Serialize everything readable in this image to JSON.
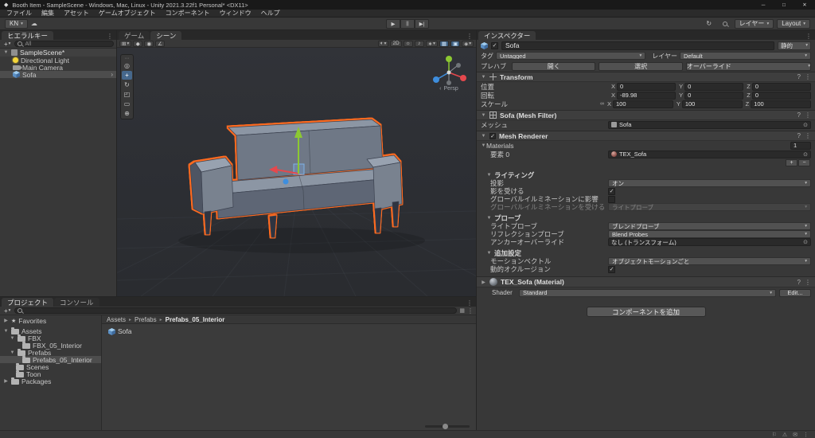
{
  "window": {
    "title": "Booth Item - SampleScene - Windows, Mac, Linux - Unity 2021.3.22f1 Personal* <DX11>"
  },
  "menu": {
    "items": [
      "ファイル",
      "編集",
      "アセット",
      "ゲームオブジェクト",
      "コンポーネント",
      "ウィンドウ",
      "ヘルプ"
    ]
  },
  "toolbar": {
    "account": "KN",
    "layers": "レイヤー",
    "layout": "Layout"
  },
  "hierarchy": {
    "tab": "ヒエラルキー",
    "search_filter": "All",
    "scene_row": "SampleScene*",
    "items": [
      {
        "label": "Directional Light"
      },
      {
        "label": "Main Camera"
      },
      {
        "label": "Sofa"
      }
    ]
  },
  "scene": {
    "tabs": [
      {
        "label": "ゲーム"
      },
      {
        "label": "シーン"
      }
    ],
    "toggle_2d": "2D",
    "persp_label": "Persp"
  },
  "inspector": {
    "tab": "インスペクター",
    "header": {
      "name": "Sofa",
      "static_label": "静的"
    },
    "tag": {
      "label": "タグ",
      "value": "Untagged"
    },
    "layer": {
      "label": "レイヤー",
      "value": "Default"
    },
    "prefab": {
      "label": "プレハブ",
      "open": "開く",
      "select": "選択",
      "overrides": "オーバーライド"
    },
    "transform": {
      "title": "Transform",
      "axis_x": "X",
      "axis_y": "Y",
      "axis_z": "Z",
      "rows": [
        {
          "label": "位置",
          "x": "0",
          "y": "0",
          "z": "0"
        },
        {
          "label": "回転",
          "x": "-89.98",
          "y": "0",
          "z": "0"
        },
        {
          "label": "スケール",
          "x": "100",
          "y": "100",
          "z": "100"
        }
      ]
    },
    "mesh_filter": {
      "title": "Sofa (Mesh Filter)",
      "mesh_label": "メッシュ",
      "mesh_value": "Sofa"
    },
    "mesh_renderer": {
      "title": "Mesh Renderer",
      "materials": {
        "label": "Materials",
        "count": "1",
        "element_label": "要素 0",
        "element_value": "TEX_Sofa"
      },
      "lighting": {
        "title": "ライティング",
        "cast_shadows_label": "投影",
        "cast_shadows_value": "オン",
        "receive_shadows_label": "影を受ける",
        "contribute_gi_label": "グローバルイルミネーションに影響",
        "receive_gi_label": "グローバルイルミネーションを受ける",
        "receive_gi_value": "ライトプローブ"
      },
      "probes": {
        "title": "プローブ",
        "light_probes_label": "ライトプローブ",
        "light_probes_value": "ブレンドプローブ",
        "reflection_probes_label": "リフレクションプローブ",
        "reflection_probes_value": "Blend Probes",
        "anchor_label": "アンカーオーバーライド",
        "anchor_value": "なし (トランスフォーム)"
      },
      "additional": {
        "title": "追加設定",
        "motion_vectors_label": "モーションベクトル",
        "motion_vectors_value": "オブジェクトモーションごと",
        "dynamic_occlusion_label": "動的オクルージョン"
      }
    },
    "material": {
      "title": "TEX_Sofa (Material)",
      "shader_label": "Shader",
      "shader_value": "Standard",
      "edit_button": "Edit..."
    },
    "add_component": "コンポーネントを追加"
  },
  "project": {
    "tabs": [
      {
        "label": "プロジェクト"
      },
      {
        "label": "コンソール"
      }
    ],
    "favorites_label": "Favorites",
    "tree": [
      {
        "label": "Assets"
      },
      {
        "label": "FBX"
      },
      {
        "label": "FBX_05_Interior"
      },
      {
        "label": "Prefabs"
      },
      {
        "label": "Prefabs_05_Interior"
      },
      {
        "label": "Scenes"
      },
      {
        "label": "Toon"
      },
      {
        "label": "Packages"
      }
    ],
    "breadcrumb": [
      "Assets",
      "Prefabs",
      "Prefabs_05_Interior"
    ],
    "content_item": "Sofa"
  },
  "icons": {
    "unity_logo": "◆",
    "cloud": "☁",
    "dropdown": "▾",
    "foldout_open": "▼",
    "foldout_closed": "▶",
    "check": "✓",
    "more": "⋮",
    "help": "?",
    "plus": "+",
    "minus": "−",
    "play": "▶",
    "pause": "||",
    "step": "▶|",
    "minimize": "─",
    "maximize": "□",
    "close": "✕",
    "picker": "⊙",
    "link": "∞",
    "prefab_arrow": "›",
    "breadcrumb_sep": "▸",
    "star": "★",
    "collapse": "‹",
    "grip": "⋯",
    "view_tool": "◎",
    "move_tool": "+",
    "rotate_tool": "↻",
    "scale_tool": "◰",
    "rect_tool": "▭",
    "transform_tool": "⊕",
    "grid": "⊞",
    "pivot": "◆",
    "orientation": "◉",
    "snap": "∠",
    "render_mode": "◐",
    "lighting": "☼",
    "audio": "♪",
    "effects": "∗",
    "grid_vis": "▦",
    "camera_gizmo": "▣",
    "gizmo": "◈",
    "flag": "⚐",
    "warning": "⚠",
    "mail": "✉"
  },
  "colors": {
    "selection_outline": "#FF6A1F",
    "accent_blue": "#4F80BD",
    "axis_x": "#E5484D",
    "axis_y": "#8CC832",
    "axis_z": "#3E8EDE"
  }
}
